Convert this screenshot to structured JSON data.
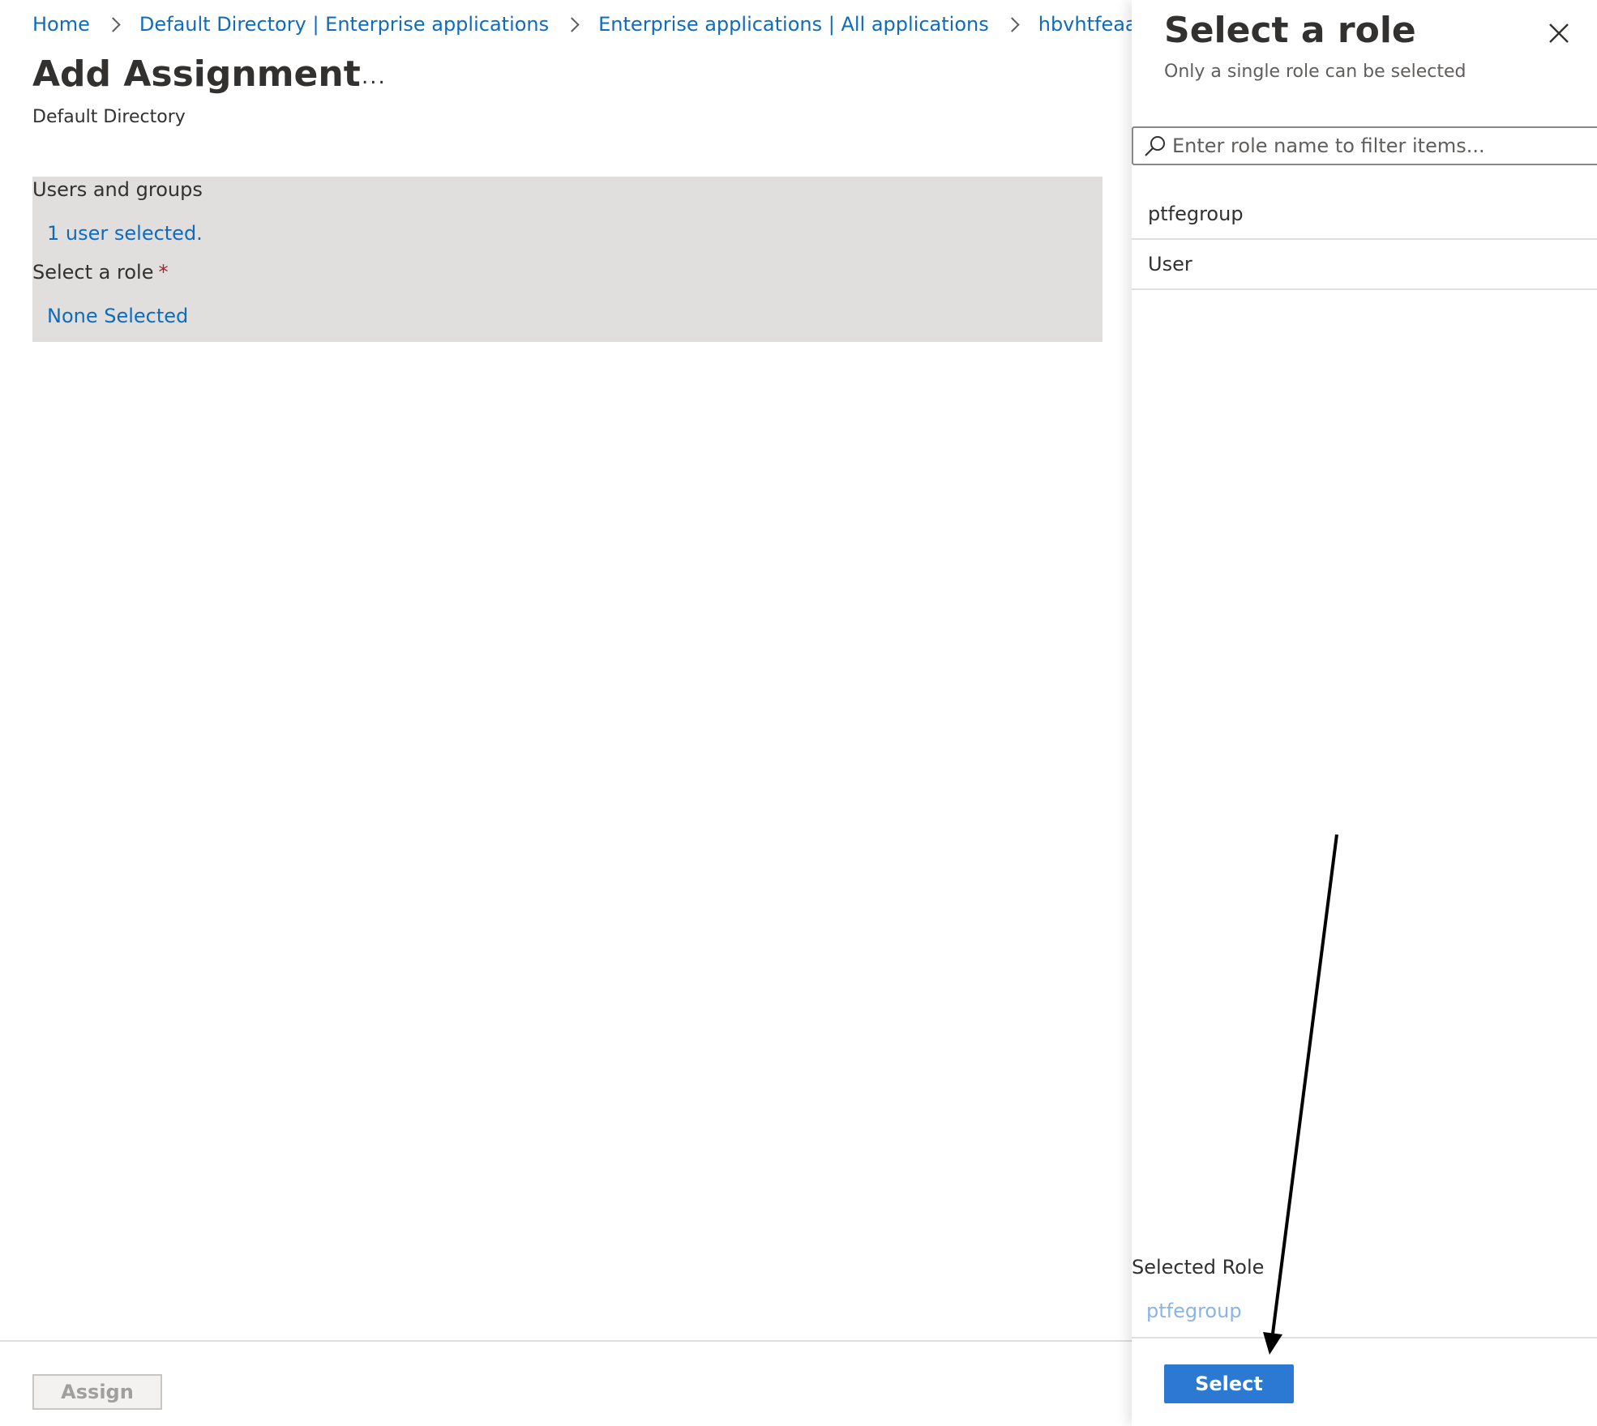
{
  "breadcrumb": {
    "items": [
      "Home",
      "Default Directory | Enterprise applications",
      "Enterprise applications | All applications",
      "hbvhtfeaa | U"
    ]
  },
  "page": {
    "title": "Add Assignment",
    "more_label": "...",
    "subtitle": "Default Directory"
  },
  "assignment": {
    "users_label": "Users and groups",
    "users_value": "1 user selected.",
    "role_label": "Select a role",
    "required_mark": "*",
    "role_value": "None Selected"
  },
  "footer": {
    "assign_label": "Assign"
  },
  "panel": {
    "title": "Select a role",
    "subtitle": "Only a single role can be selected",
    "close_icon": "close-icon",
    "search": {
      "placeholder": "Enter role name to filter items...",
      "icon": "search-icon"
    },
    "roles": [
      "ptfegroup",
      "User"
    ],
    "selected_label": "Selected Role",
    "selected_value": "ptfegroup",
    "select_label": "Select"
  },
  "colors": {
    "link": "#0f6cbd",
    "primary_button": "#2b79d2",
    "box_background": "#e1dfdd",
    "required": "#a4262c"
  }
}
